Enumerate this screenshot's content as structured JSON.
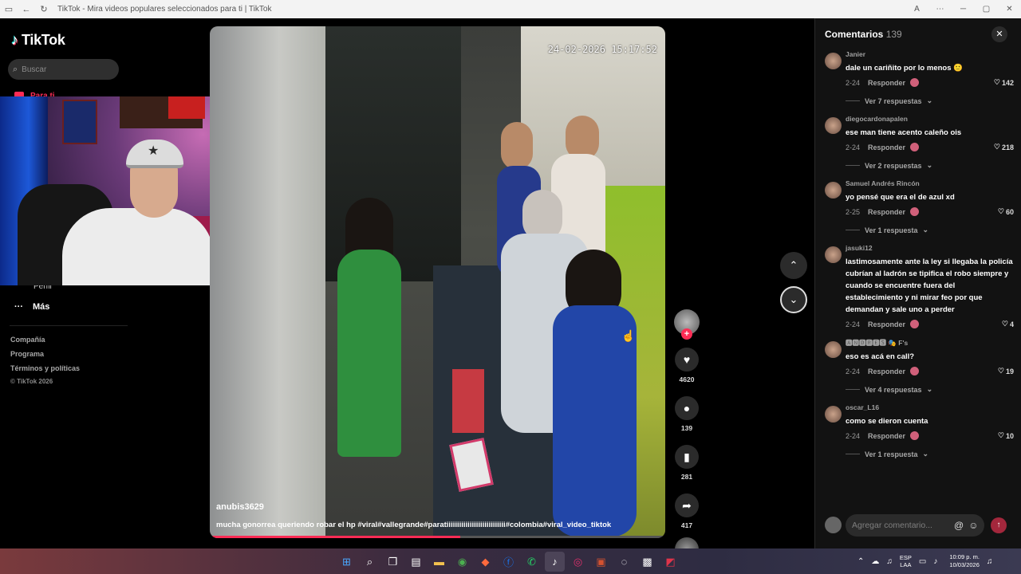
{
  "browser": {
    "title": "TikTok - Mira videos populares seleccionados para ti | TikTok"
  },
  "sidebar": {
    "logo_text": "TikTok",
    "search_placeholder": "Buscar",
    "partial_nav_label": "Para ti",
    "partial_profile_label": "Perfil",
    "more_label": "Más",
    "footer": {
      "company": "Compañía",
      "program": "Programa",
      "terms": "Términos y políticas",
      "copyright": "© TikTok 2026"
    }
  },
  "video": {
    "timestamp": "24-02-2026 15:17:52",
    "author": "anubis3629",
    "caption": "mucha gonorrea queriendo robar el hp #viral#vallegrande#paratiiiiiiiiiiiiiiiiiiiiiiiiiiii#colombia#viral_video_tiktok",
    "progress": 0.55
  },
  "actions": {
    "likes": "4620",
    "comments": "139",
    "saves": "281",
    "shares": "417"
  },
  "comments_panel": {
    "title": "Comentarios",
    "count": "139",
    "input_placeholder": "Agregar comentario...",
    "reply_label": "Responder",
    "items": [
      {
        "user": "Janier",
        "text": "dale un cariñito por lo menos 🙂",
        "date": "2-24",
        "likes": "142",
        "replies": "Ver 7 respuestas"
      },
      {
        "user": "diegocardonapalen",
        "text": "ese man tiene acento caleño ois",
        "date": "2-24",
        "likes": "218",
        "replies": "Ver 2 respuestas"
      },
      {
        "user": "Samuel Andrés Rincón",
        "text": "yo pensé que era el de azul xd",
        "date": "2-25",
        "likes": "60",
        "replies": "Ver 1 respuesta"
      },
      {
        "user": "jasuki12",
        "text": "lastimosamente ante la ley si llegaba la policía cubrían al ladrón se tipifica el robo siempre y cuando se encuentre fuera del establecimiento y ni mirar feo por que demandan y sale uno a perder",
        "date": "2-24",
        "likes": "4",
        "replies": ""
      },
      {
        "user": "🅰🅽🅳🆁🅴🆂 🎭 F's",
        "text": "eso es acá en call?",
        "date": "2-24",
        "likes": "19",
        "replies": "Ver 4 respuestas"
      },
      {
        "user": "oscar_L16",
        "text": "como se dieron cuenta",
        "date": "2-24",
        "likes": "10",
        "replies": "Ver 1 respuesta"
      }
    ]
  },
  "taskbar": {
    "lang_line1": "ESP",
    "lang_line2": "LAA",
    "time": "10:09 p. m.",
    "date": "10/03/2026"
  },
  "colors": {
    "accent": "#fe2c55",
    "panel_bg": "#121212",
    "button_bg": "#2b2b2b"
  }
}
